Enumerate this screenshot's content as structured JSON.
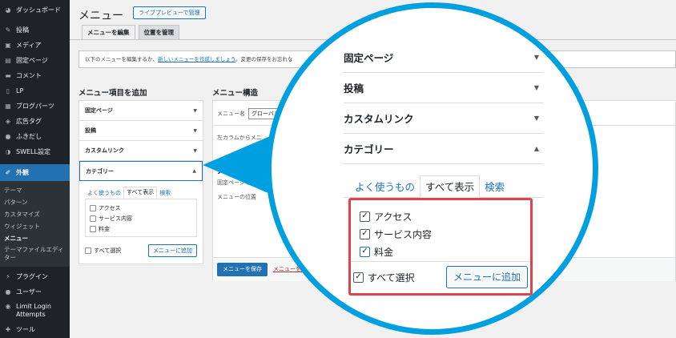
{
  "sidebar": {
    "items": [
      {
        "label": "ダッシュボード",
        "icon": "dashboard-icon"
      },
      {
        "label": "投稿",
        "icon": "pin-icon"
      },
      {
        "label": "メディア",
        "icon": "media-icon"
      },
      {
        "label": "固定ページ",
        "icon": "page-icon"
      },
      {
        "label": "コメント",
        "icon": "comment-icon"
      },
      {
        "label": "LP",
        "icon": "lp-icon"
      },
      {
        "label": "ブログパーツ",
        "icon": "blogparts-icon"
      },
      {
        "label": "広告タグ",
        "icon": "adtag-icon"
      },
      {
        "label": "ふきだし",
        "icon": "balloon-icon"
      },
      {
        "label": "SWELL設定",
        "icon": "swell-icon"
      },
      {
        "label": "外観",
        "icon": "brush-icon"
      }
    ],
    "submenu": [
      "テーマ",
      "パターン",
      "カスタマイズ",
      "ウィジェット",
      "メニュー",
      "テーマファイルエディター"
    ],
    "bottom_items": [
      {
        "label": "プラグイン",
        "icon": "plugin-icon"
      },
      {
        "label": "ユーザー",
        "icon": "user-icon"
      },
      {
        "label": "Limit Login Attempts",
        "icon": "lock-icon"
      },
      {
        "label": "ツール",
        "icon": "wrench-icon"
      }
    ]
  },
  "header": {
    "title": "メニュー",
    "preview_button": "ライブプレビューで管理",
    "tabs": [
      "メニューを編集",
      "位置を管理"
    ]
  },
  "notice": {
    "text_before": "以下のメニューを編集するか、",
    "link": "新しいメニューを作成しましょう",
    "text_after": "。変更の保存をお忘れな"
  },
  "add_items": {
    "heading": "メニュー項目を追加",
    "sections": [
      "固定ページ",
      "投稿",
      "カスタムリンク",
      "カテゴリー"
    ],
    "category_tabs": [
      "よく使うもの",
      "すべて表示",
      "検索"
    ],
    "categories": [
      "アクセス",
      "サービス内容",
      "料金"
    ],
    "select_all": "すべて選択",
    "add_button": "メニューに追加"
  },
  "structure": {
    "heading": "メニュー構造",
    "name_label": "メニュー名",
    "name_value": "グローバル",
    "hint": "左カラムからメニ",
    "settings_heading": "メ",
    "settings_text": "固定ページを",
    "location_text": "メニューの位置",
    "save_button": "メニューを保存",
    "delete_link": "メニューを削"
  },
  "zoom": {
    "sections": [
      "固定ページ",
      "投稿",
      "カスタムリンク",
      "カテゴリー"
    ],
    "tabs": [
      "よく使うもの",
      "すべて表示",
      "検索"
    ],
    "categories": [
      "アクセス",
      "サービス内容",
      "料金"
    ],
    "checked": [
      true,
      true,
      true
    ],
    "select_all": "すべて選択",
    "add_button": "メニューに追加",
    "highlight_color": "#e0434e",
    "callout_color": "#00a0e0"
  }
}
